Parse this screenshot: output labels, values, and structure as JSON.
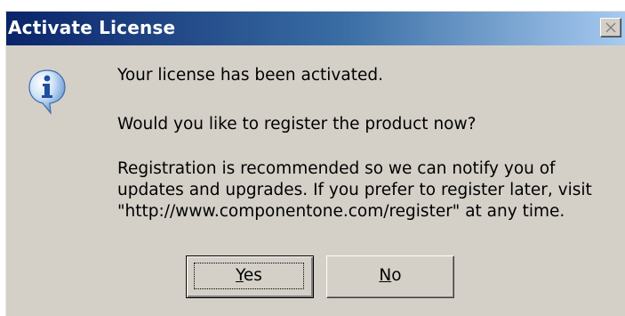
{
  "window": {
    "title": "Activate License",
    "close_icon": "close-icon"
  },
  "message": {
    "icon": "information-icon",
    "line1": "Your license has been activated.",
    "line2": "Would you like to register the product now?",
    "line3": [
      "Registration is recommended so we can notify you of",
      "updates and upgrades. If you prefer to register later, visit",
      "\"http://www.componentone.com/register\" at any time."
    ]
  },
  "buttons": {
    "yes": {
      "accel": "Y",
      "rest": "es"
    },
    "no": {
      "accel": "N",
      "rest": "o"
    }
  },
  "colors": {
    "titlebar_start": "#0a246a",
    "titlebar_end": "#a6caf0",
    "dialog_bg": "#d4d0c8"
  }
}
